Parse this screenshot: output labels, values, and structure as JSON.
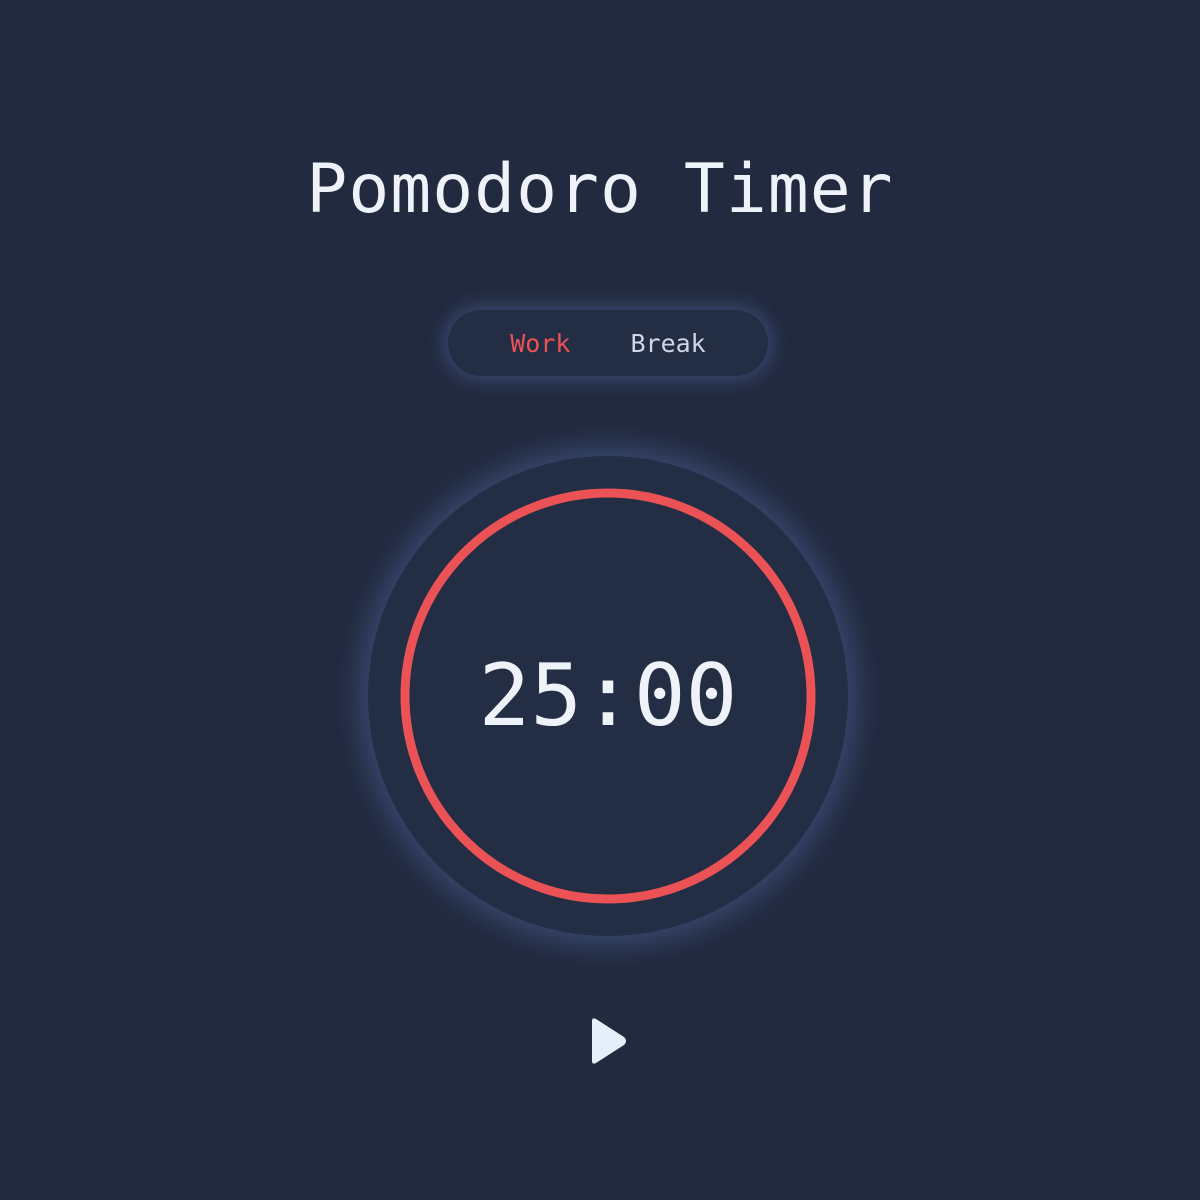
{
  "app": {
    "title": "Pomodoro Timer"
  },
  "modes": {
    "active": "Work",
    "items": [
      {
        "label": "Work"
      },
      {
        "label": "Break"
      }
    ]
  },
  "timer": {
    "minutes": "25",
    "separator": ":",
    "seconds": "00",
    "progress": 1.0
  },
  "controls": {
    "play_icon": "play-icon"
  },
  "colors": {
    "background": "#212a3f",
    "accent": "#ea5255",
    "text": "#eef2f9"
  }
}
